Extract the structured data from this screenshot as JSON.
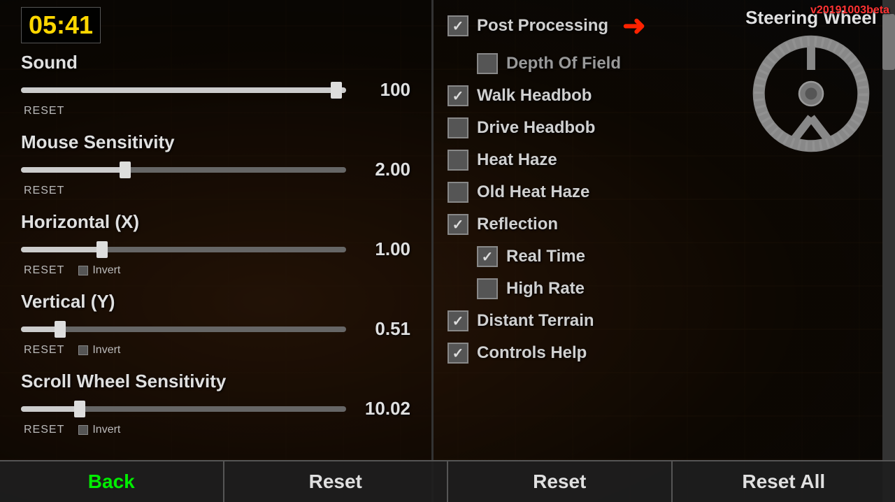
{
  "timer": {
    "value": "05:41"
  },
  "version": "v20191003beta",
  "left_panel": {
    "sliders": [
      {
        "label": "Sound",
        "value": "100",
        "fill_percent": 100,
        "thumb_percent": 97,
        "show_reset": true,
        "show_invert": false,
        "reset_label": "RESET"
      },
      {
        "label": "Mouse Sensitivity",
        "value": "2.00",
        "fill_percent": 32,
        "thumb_percent": 32,
        "show_reset": true,
        "show_invert": false,
        "reset_label": "RESET"
      },
      {
        "label": "Horizontal (X)",
        "value": "1.00",
        "fill_percent": 25,
        "thumb_percent": 25,
        "show_reset": true,
        "show_invert": true,
        "reset_label": "RESET",
        "invert_label": "Invert"
      },
      {
        "label": "Vertical (Y)",
        "value": "0.51",
        "fill_percent": 12,
        "thumb_percent": 12,
        "show_reset": true,
        "show_invert": true,
        "reset_label": "RESET",
        "invert_label": "Invert"
      },
      {
        "label": "Scroll Wheel Sensitivity",
        "value": "10.02",
        "fill_percent": 18,
        "thumb_percent": 18,
        "show_reset": true,
        "show_invert": true,
        "reset_label": "RESET",
        "invert_label": "Invert"
      }
    ]
  },
  "right_panel": {
    "steering_wheel_title": "Steering Wheel",
    "options": [
      {
        "id": "post_processing",
        "label": "Post Processing",
        "checked": true,
        "indented": false,
        "has_arrow": true
      },
      {
        "id": "depth_of_field",
        "label": "Depth Of Field",
        "checked": false,
        "indented": true,
        "dimmed": true
      },
      {
        "id": "walk_headbob",
        "label": "Walk Headbob",
        "checked": true,
        "indented": false
      },
      {
        "id": "drive_headbob",
        "label": "Drive Headbob",
        "checked": false,
        "indented": false
      },
      {
        "id": "heat_haze",
        "label": "Heat Haze",
        "checked": false,
        "indented": false
      },
      {
        "id": "old_heat_haze",
        "label": "Old Heat Haze",
        "checked": false,
        "indented": false
      },
      {
        "id": "reflection",
        "label": "Reflection",
        "checked": true,
        "indented": false
      },
      {
        "id": "real_time",
        "label": "Real Time",
        "checked": true,
        "indented": true
      },
      {
        "id": "high_rate",
        "label": "High Rate",
        "checked": false,
        "indented": true
      },
      {
        "id": "distant_terrain",
        "label": "Distant Terrain",
        "checked": true,
        "indented": false
      },
      {
        "id": "controls_help",
        "label": "Controls Help",
        "checked": true,
        "indented": false
      }
    ]
  },
  "buttons": {
    "back": "Back",
    "reset1": "Reset",
    "reset2": "Reset",
    "reset_all": "Reset All"
  }
}
